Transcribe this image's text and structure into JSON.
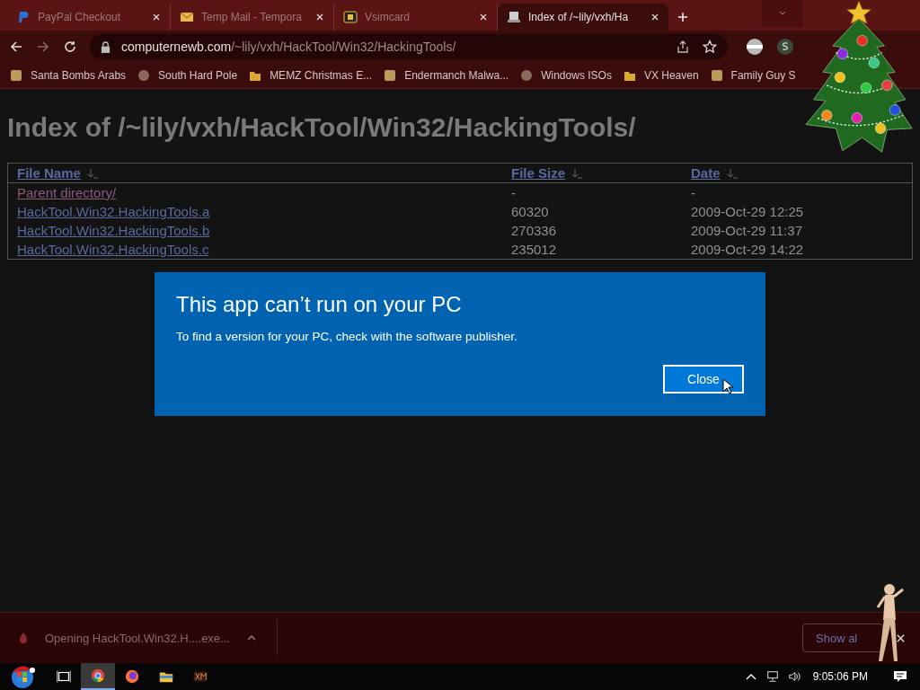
{
  "tabs": [
    {
      "title": "PayPal Checkout",
      "selected": false
    },
    {
      "title": "Temp Mail - Tempora",
      "selected": false
    },
    {
      "title": "Vsimcard",
      "selected": false
    },
    {
      "title": "Index of /~lily/vxh/Ha",
      "selected": true
    }
  ],
  "address": {
    "host": "computernewb.com",
    "path": "/~lily/vxh/HackTool/Win32/HackingTools/"
  },
  "bookmarks": [
    "Santa Bombs Arabs",
    "South Hard Pole",
    "MEMZ Christmas E...",
    "Endermanch Malwa...",
    "Windows ISOs",
    "VX Heaven",
    "Family Guy S"
  ],
  "page": {
    "heading": "Index of /~lily/vxh/HackTool/Win32/HackingTools/",
    "table": {
      "columns": [
        "File Name",
        "File Size",
        "Date"
      ],
      "rows": [
        [
          "Parent directory/",
          "-",
          "-"
        ],
        [
          "HackTool.Win32.HackingTools.a",
          "60320",
          "2009-Oct-29 12:25"
        ],
        [
          "HackTool.Win32.HackingTools.b",
          "270336",
          "2009-Oct-29 11:37"
        ],
        [
          "HackTool.Win32.HackingTools.c",
          "235012",
          "2009-Oct-29 14:22"
        ]
      ]
    }
  },
  "dialog": {
    "title": "This app can’t run on your PC",
    "message": "To find a version for your PC, check with the software publisher.",
    "button": "Close"
  },
  "download_bar": {
    "item": "Opening HackTool.Win32.H....exe...",
    "show_all": "Show al"
  },
  "taskbar": {
    "apps": [
      {
        "kind": "taskview",
        "selected": false
      },
      {
        "kind": "chrome",
        "selected": true
      },
      {
        "kind": "firefox",
        "selected": false
      },
      {
        "kind": "explorer",
        "selected": false
      },
      {
        "kind": "xm",
        "selected": false
      }
    ],
    "time": "9:05:06 PM"
  }
}
